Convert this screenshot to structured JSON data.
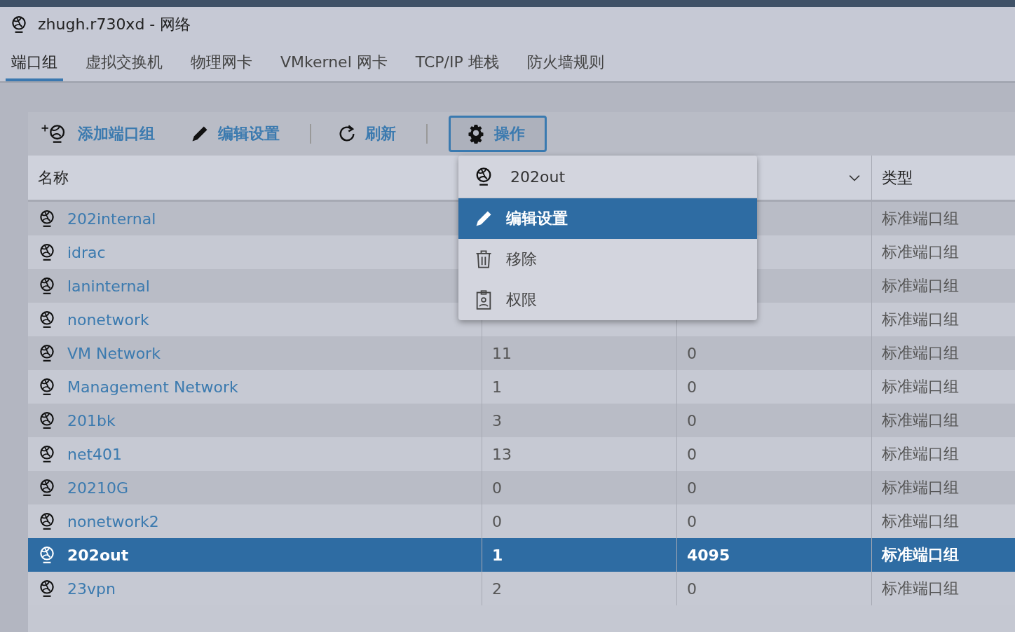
{
  "window": {
    "title": "zhugh.r730xd - 网络"
  },
  "tabs": [
    {
      "label": "端口组",
      "selected": true
    },
    {
      "label": "虚拟交换机",
      "selected": false
    },
    {
      "label": "物理网卡",
      "selected": false
    },
    {
      "label": "VMkernel 网卡",
      "selected": false
    },
    {
      "label": "TCP/IP 堆栈",
      "selected": false
    },
    {
      "label": "防火墙规则",
      "selected": false
    }
  ],
  "toolbar": [
    {
      "kind": "add",
      "label": "添加端口组",
      "selected": false
    },
    {
      "kind": "edit",
      "label": "编辑设置",
      "selected": false
    },
    {
      "kind": "refresh",
      "label": "刷新",
      "selected": false
    },
    {
      "kind": "actions",
      "label": "操作",
      "selected": true
    }
  ],
  "table": {
    "columns": [
      {
        "label": "名称"
      },
      {
        "kind": "plain"
      },
      {
        "kind": "menu"
      },
      {
        "label": "类型"
      }
    ],
    "rows": [
      {
        "name": "202internal",
        "column_2": null,
        "column_3": null,
        "type": "标准端口组",
        "selected": false
      },
      {
        "name": "idrac",
        "column_2": null,
        "column_3": null,
        "type": "标准端口组",
        "selected": false
      },
      {
        "name": "laninternal",
        "column_2": null,
        "column_3": null,
        "type": "标准端口组",
        "selected": false
      },
      {
        "name": "nonetwork",
        "column_2": null,
        "column_3": null,
        "type": "标准端口组",
        "selected": false
      },
      {
        "name": "VM Network",
        "column_2": "11",
        "column_3": "0",
        "type": "标准端口组",
        "selected": false
      },
      {
        "name": "Management Network",
        "column_2": "1",
        "column_3": "0",
        "type": "标准端口组",
        "selected": false
      },
      {
        "name": "201bk",
        "column_2": "3",
        "column_3": "0",
        "type": "标准端口组",
        "selected": false
      },
      {
        "name": "net401",
        "column_2": "13",
        "column_3": "0",
        "type": "标准端口组",
        "selected": false
      },
      {
        "name": "20210G",
        "column_2": "0",
        "column_3": "0",
        "type": "标准端口组",
        "selected": false
      },
      {
        "name": "nonetwork2",
        "column_2": "0",
        "column_3": "0",
        "type": "标准端口组",
        "selected": false
      },
      {
        "name": "202out",
        "column_2": "1",
        "column_3": "4095",
        "type": "标准端口组",
        "selected": true
      },
      {
        "name": "23vpn",
        "column_2": "2",
        "column_3": "0",
        "type": "标准端口组",
        "selected": false
      }
    ]
  },
  "menu": {
    "title": "202out",
    "items": [
      {
        "kind": "edit",
        "label": "编辑设置",
        "selected": true
      },
      {
        "kind": "remove",
        "label": "移除",
        "selected": false
      },
      {
        "kind": "permissions",
        "label": "权限",
        "selected": false
      }
    ]
  }
}
